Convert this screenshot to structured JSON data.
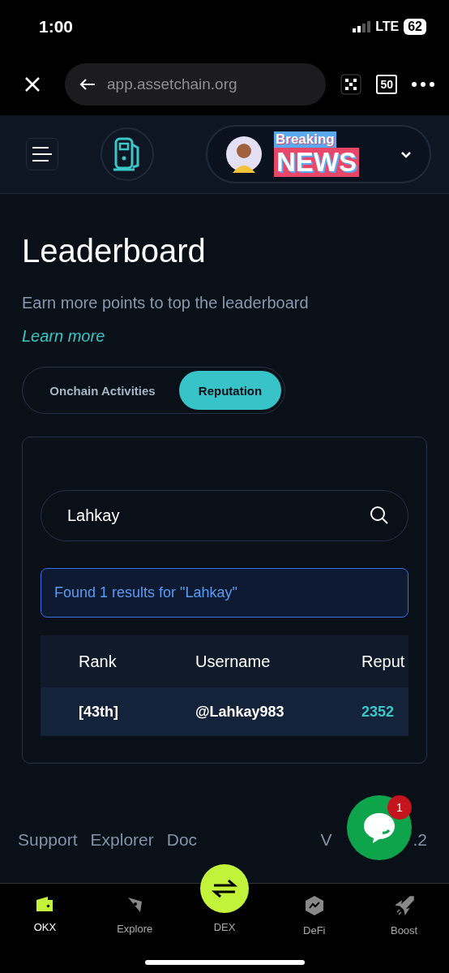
{
  "status_bar": {
    "time": "1:00",
    "network": "LTE",
    "battery": "62"
  },
  "browser": {
    "url": "app.assetchain.org",
    "tabs_count": "50"
  },
  "header": {
    "sticker_top": "Breaking",
    "sticker_bottom": "NEWS"
  },
  "title": "Leaderboard",
  "subtitle": "Earn more points to top the leaderboard",
  "learn_more": "Learn more",
  "tabs": [
    {
      "label": "Onchain Activities",
      "selected": false
    },
    {
      "label": "Reputation",
      "selected": true
    }
  ],
  "search": {
    "value": "Lahkay"
  },
  "result_message": "Found 1 results for \"Lahkay\"",
  "table": {
    "columns": [
      "Rank",
      "Username",
      "Reput"
    ],
    "rows": [
      [
        "[43th]",
        "@Lahkay983",
        "2352"
      ]
    ]
  },
  "footer": {
    "links": [
      "Support",
      "Explorer",
      "Doc"
    ],
    "version_start": "V",
    "version_end": ".2"
  },
  "chat": {
    "badge": "1"
  },
  "bottom_nav": [
    {
      "label": "OKX",
      "selected": true,
      "kind": "wallet"
    },
    {
      "label": "Explore",
      "selected": false,
      "kind": "compass"
    },
    {
      "label": "DEX",
      "selected": false,
      "kind": "swap"
    },
    {
      "label": "DeFi",
      "selected": false,
      "kind": "hex"
    },
    {
      "label": "Boost",
      "selected": false,
      "kind": "rocket"
    }
  ]
}
